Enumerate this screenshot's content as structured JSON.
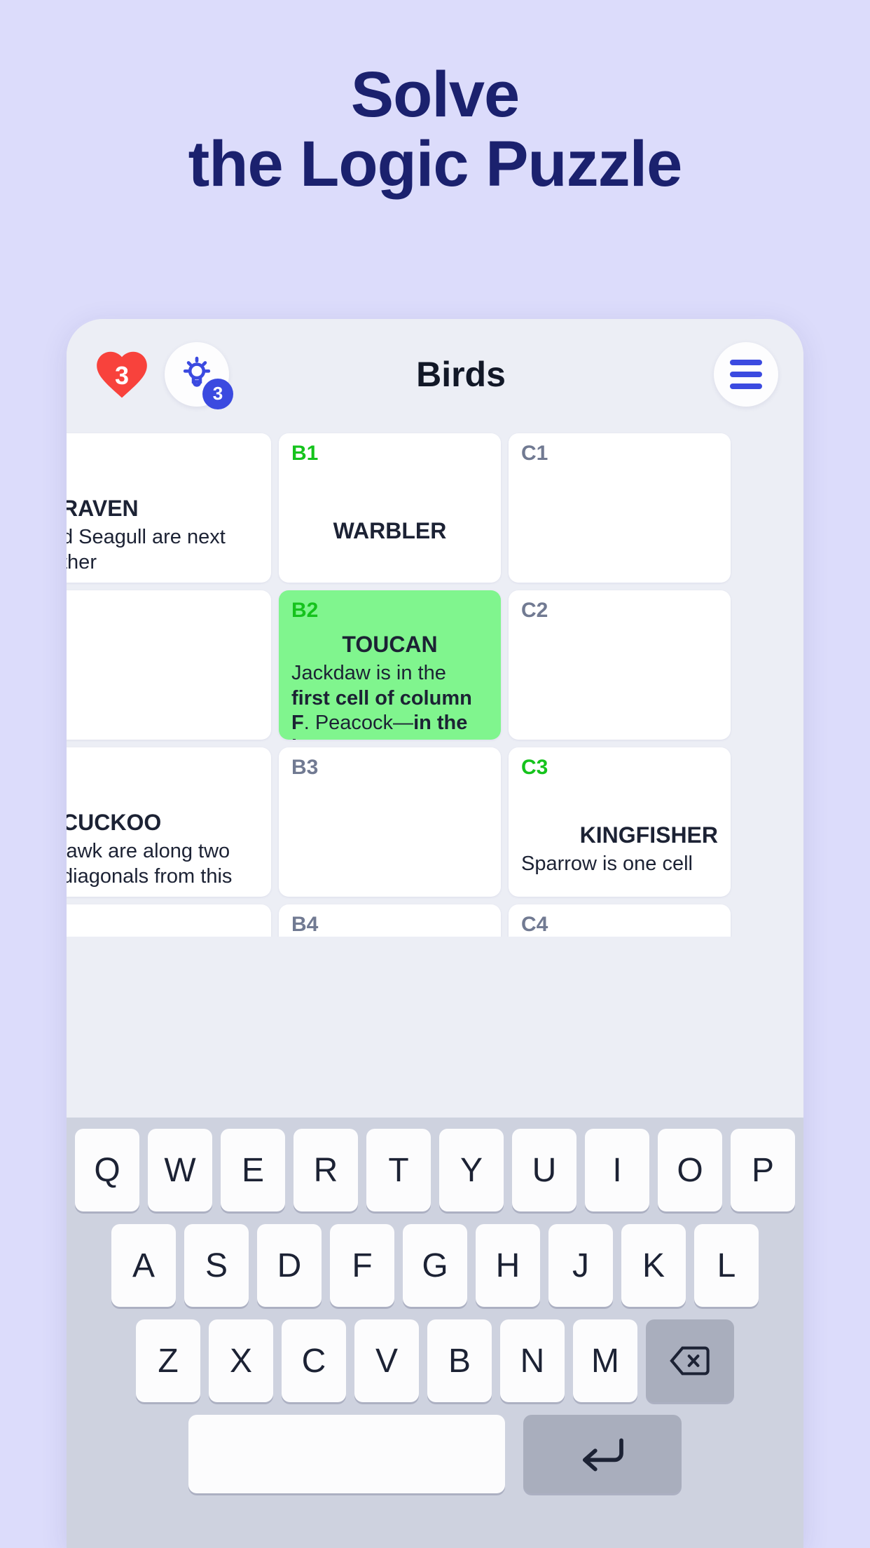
{
  "promo": {
    "line1": "Solve",
    "line2": "the Logic Puzzle",
    "color": "#1b216e"
  },
  "app": {
    "title": "Birds",
    "lives": "3",
    "hints_badge": "3",
    "heart_icon": "heart-icon",
    "bulb_icon": "lightbulb-icon",
    "menu_icon": "hamburger-menu-icon",
    "accent_blue": "#3b4ae0",
    "heart_red": "#f8423c",
    "solved_green": "#15c31c",
    "active_cell_bg": "#80f58e"
  },
  "grid": {
    "cells": [
      {
        "id": "A1",
        "id_visible": false,
        "solved": true,
        "word": "RAVEN",
        "clue_plain": "d Seagull are next",
        "clue_plain2": "ther",
        "state": "clipped-left"
      },
      {
        "id": "B1",
        "id_visible": true,
        "solved": true,
        "word": "WARBLER",
        "clue_plain": "",
        "state": "solved"
      },
      {
        "id": "C1",
        "id_visible": true,
        "solved": false,
        "word": "",
        "clue_plain": "",
        "state": "empty"
      },
      {
        "id": "A2",
        "id_visible": false,
        "solved": false,
        "word": "",
        "clue_plain": "",
        "state": "empty"
      },
      {
        "id": "B2",
        "id_visible": true,
        "solved": true,
        "active": true,
        "word": "TOUCAN",
        "clue_rich": "Jackdaw is in the <b>first cell of column F</b>. Peacock—<b>in the last</b>",
        "state": "active"
      },
      {
        "id": "C2",
        "id_visible": true,
        "solved": false,
        "word": "",
        "clue_plain": "",
        "state": "empty"
      },
      {
        "id": "A3",
        "id_visible": false,
        "solved": true,
        "word": "CUCKOO",
        "clue_plain": "lawk are along two",
        "clue_plain2": "diagonals from this",
        "state": "clipped-left"
      },
      {
        "id": "B3",
        "id_visible": true,
        "solved": false,
        "word": "",
        "clue_plain": "",
        "state": "empty"
      },
      {
        "id": "C3",
        "id_visible": true,
        "solved": true,
        "word": "KINGFISHER",
        "clue_plain": "Sparrow is one cell",
        "state": "clipped-right"
      },
      {
        "id": "A4",
        "id_visible": false,
        "solved": false,
        "word": "",
        "clue_plain": "",
        "state": "empty"
      },
      {
        "id": "B4",
        "id_visible": true,
        "solved": false,
        "word": "",
        "clue_plain": "",
        "state": "empty"
      },
      {
        "id": "C4",
        "id_visible": true,
        "solved": false,
        "word": "",
        "clue_plain": "",
        "state": "empty"
      }
    ]
  },
  "keyboard": {
    "row1": [
      "Q",
      "W",
      "E",
      "R",
      "T",
      "Y",
      "U",
      "I",
      "O",
      "P"
    ],
    "row2": [
      "A",
      "S",
      "D",
      "F",
      "G",
      "H",
      "J",
      "K",
      "L"
    ],
    "row3": [
      "Z",
      "X",
      "C",
      "V",
      "B",
      "N",
      "M"
    ],
    "backspace_icon": "backspace-icon",
    "enter_icon": "enter-return-icon",
    "space_label": "",
    "key_bg": "#fcfcfd",
    "fn_key_bg": "#a9aebd",
    "keyboard_bg": "#ced2df"
  }
}
